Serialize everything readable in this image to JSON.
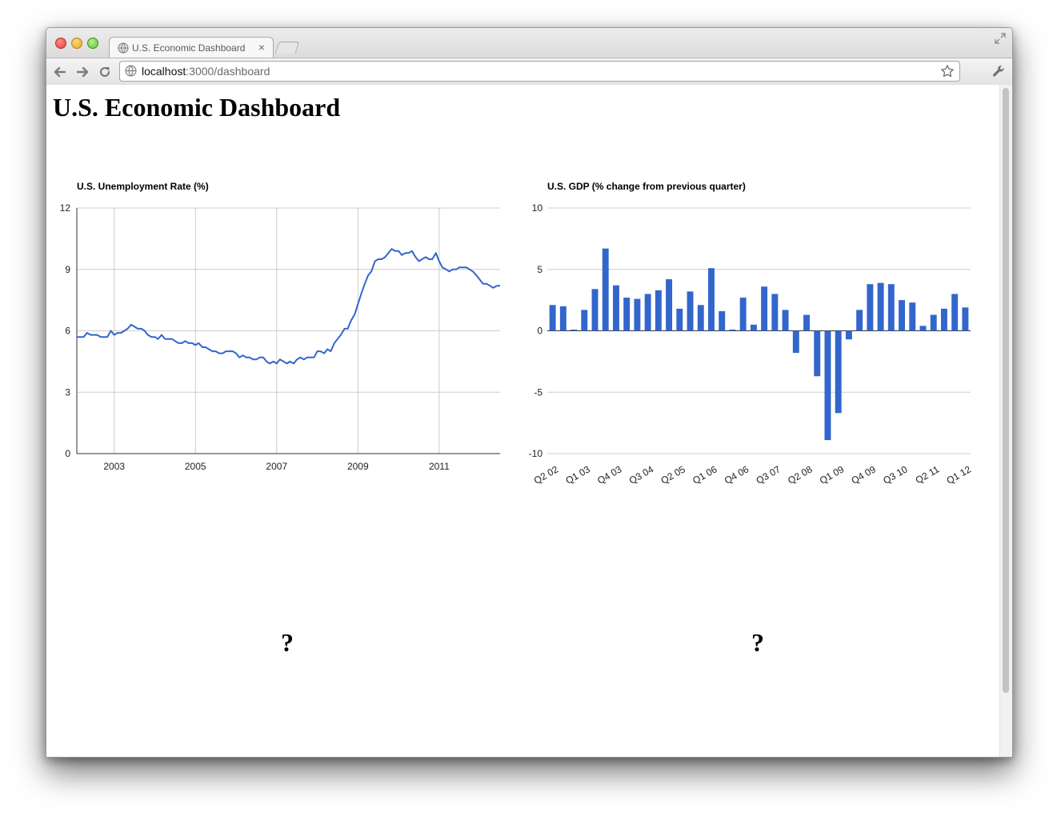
{
  "browser": {
    "tab_title": "U.S. Economic Dashboard",
    "tab_close": "×",
    "url_host": "localhost",
    "url_path": ":3000/dashboard"
  },
  "page": {
    "title": "U.S. Economic Dashboard",
    "placeholder_left": "?",
    "placeholder_right": "?"
  },
  "chart_data": [
    {
      "type": "line",
      "title": "U.S. Unemployment Rate (%)",
      "xlabel": "",
      "ylabel": "",
      "x": [
        2002.08,
        2002.17,
        2002.25,
        2002.33,
        2002.42,
        2002.5,
        2002.58,
        2002.67,
        2002.75,
        2002.83,
        2002.92,
        2003.0,
        2003.08,
        2003.17,
        2003.25,
        2003.33,
        2003.42,
        2003.5,
        2003.58,
        2003.67,
        2003.75,
        2003.83,
        2003.92,
        2004.0,
        2004.08,
        2004.17,
        2004.25,
        2004.33,
        2004.42,
        2004.5,
        2004.58,
        2004.67,
        2004.75,
        2004.83,
        2004.92,
        2005.0,
        2005.08,
        2005.17,
        2005.25,
        2005.33,
        2005.42,
        2005.5,
        2005.58,
        2005.67,
        2005.75,
        2005.83,
        2005.92,
        2006.0,
        2006.08,
        2006.17,
        2006.25,
        2006.33,
        2006.42,
        2006.5,
        2006.58,
        2006.67,
        2006.75,
        2006.83,
        2006.92,
        2007.0,
        2007.08,
        2007.17,
        2007.25,
        2007.33,
        2007.42,
        2007.5,
        2007.58,
        2007.67,
        2007.75,
        2007.83,
        2007.92,
        2008.0,
        2008.08,
        2008.17,
        2008.25,
        2008.33,
        2008.42,
        2008.5,
        2008.58,
        2008.67,
        2008.75,
        2008.83,
        2008.92,
        2009.0,
        2009.08,
        2009.17,
        2009.25,
        2009.33,
        2009.42,
        2009.5,
        2009.58,
        2009.67,
        2009.75,
        2009.83,
        2009.92,
        2010.0,
        2010.08,
        2010.17,
        2010.25,
        2010.33,
        2010.42,
        2010.5,
        2010.58,
        2010.67,
        2010.75,
        2010.83,
        2010.92,
        2011.0,
        2011.08,
        2011.17,
        2011.25,
        2011.33,
        2011.42,
        2011.5,
        2011.58,
        2011.67,
        2011.75,
        2011.83,
        2011.92,
        2012.0,
        2012.08,
        2012.17,
        2012.25,
        2012.33,
        2012.42,
        2012.5
      ],
      "values": [
        5.7,
        5.7,
        5.7,
        5.9,
        5.8,
        5.8,
        5.8,
        5.7,
        5.7,
        5.7,
        6.0,
        5.8,
        5.9,
        5.9,
        6.0,
        6.1,
        6.3,
        6.2,
        6.1,
        6.1,
        6.0,
        5.8,
        5.7,
        5.7,
        5.6,
        5.8,
        5.6,
        5.6,
        5.6,
        5.5,
        5.4,
        5.4,
        5.5,
        5.4,
        5.4,
        5.3,
        5.4,
        5.2,
        5.2,
        5.1,
        5.0,
        5.0,
        4.9,
        4.9,
        5.0,
        5.0,
        5.0,
        4.9,
        4.7,
        4.8,
        4.7,
        4.7,
        4.6,
        4.6,
        4.7,
        4.7,
        4.5,
        4.4,
        4.5,
        4.4,
        4.6,
        4.5,
        4.4,
        4.5,
        4.4,
        4.6,
        4.7,
        4.6,
        4.7,
        4.7,
        4.7,
        5.0,
        5.0,
        4.9,
        5.1,
        5.0,
        5.4,
        5.6,
        5.8,
        6.1,
        6.1,
        6.5,
        6.8,
        7.3,
        7.8,
        8.3,
        8.7,
        8.9,
        9.4,
        9.5,
        9.5,
        9.6,
        9.8,
        10.0,
        9.9,
        9.9,
        9.7,
        9.8,
        9.8,
        9.9,
        9.6,
        9.4,
        9.5,
        9.6,
        9.5,
        9.5,
        9.8,
        9.4,
        9.1,
        9.0,
        8.9,
        9.0,
        9.0,
        9.1,
        9.1,
        9.1,
        9.0,
        8.9,
        8.7,
        8.5,
        8.3,
        8.3,
        8.2,
        8.1,
        8.2,
        8.2
      ],
      "xticks": [
        2003,
        2005,
        2007,
        2009,
        2011
      ],
      "xlim": [
        2002.08,
        2012.5
      ],
      "ylim": [
        0,
        12
      ],
      "yticks": [
        0,
        3,
        6,
        9,
        12
      ],
      "grid": true,
      "color": "#3366cc"
    },
    {
      "type": "bar",
      "title": "U.S. GDP (% change from previous quarter)",
      "xlabel": "",
      "ylabel": "",
      "categories": [
        "Q2 02",
        "Q3 02",
        "Q4 02",
        "Q1 03",
        "Q2 03",
        "Q3 03",
        "Q4 03",
        "Q1 04",
        "Q2 04",
        "Q3 04",
        "Q4 04",
        "Q1 05",
        "Q2 05",
        "Q3 05",
        "Q4 05",
        "Q1 06",
        "Q2 06",
        "Q3 06",
        "Q4 06",
        "Q1 07",
        "Q2 07",
        "Q3 07",
        "Q4 07",
        "Q1 08",
        "Q2 08",
        "Q3 08",
        "Q4 08",
        "Q1 09",
        "Q2 09",
        "Q3 09",
        "Q4 09",
        "Q1 10",
        "Q2 10",
        "Q3 10",
        "Q4 10",
        "Q1 11",
        "Q2 11",
        "Q3 11",
        "Q4 11",
        "Q1 12"
      ],
      "values": [
        2.1,
        2.0,
        0.1,
        1.7,
        3.4,
        6.7,
        3.7,
        2.7,
        2.6,
        3.0,
        3.3,
        4.2,
        1.8,
        3.2,
        2.1,
        5.1,
        1.6,
        0.1,
        2.7,
        0.5,
        3.6,
        3.0,
        1.7,
        -1.8,
        1.3,
        -3.7,
        -8.9,
        -6.7,
        -0.7,
        1.7,
        3.8,
        3.9,
        3.8,
        2.5,
        2.3,
        0.4,
        1.3,
        1.8,
        3.0,
        1.9
      ],
      "xtick_labels": [
        "Q2 02",
        "Q1 03",
        "Q4 03",
        "Q3 04",
        "Q2 05",
        "Q1 06",
        "Q4 06",
        "Q3 07",
        "Q2 08",
        "Q1 09",
        "Q4 09",
        "Q3 10",
        "Q2 11",
        "Q1 12"
      ],
      "ylim": [
        -10,
        10
      ],
      "yticks": [
        -10,
        -5,
        0,
        5,
        10
      ],
      "grid": true,
      "color": "#3366cc"
    }
  ]
}
